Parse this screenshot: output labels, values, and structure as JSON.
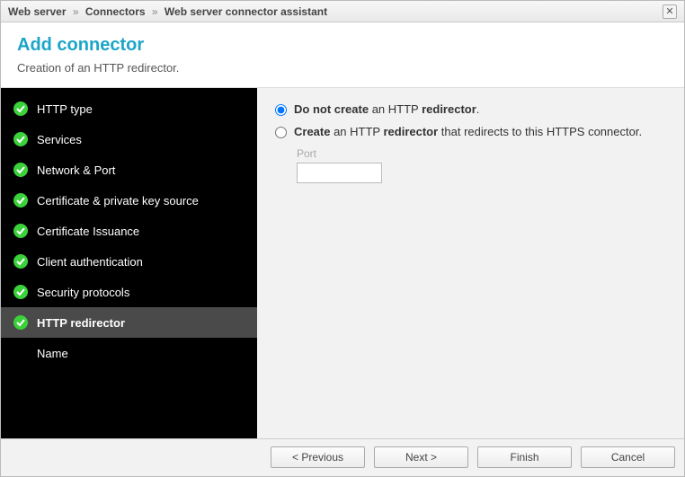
{
  "breadcrumb": {
    "p1": "Web server",
    "p2": "Connectors",
    "p3": "Web server connector assistant"
  },
  "header": {
    "title": "Add connector",
    "subtitle": "Creation of an HTTP redirector."
  },
  "sidebar": {
    "steps": [
      {
        "label": "HTTP type",
        "done": true
      },
      {
        "label": "Services",
        "done": true
      },
      {
        "label": "Network & Port",
        "done": true
      },
      {
        "label": "Certificate & private key source",
        "done": true
      },
      {
        "label": "Certificate Issuance",
        "done": true
      },
      {
        "label": "Client authentication",
        "done": true
      },
      {
        "label": "Security protocols",
        "done": true
      },
      {
        "label": "HTTP redirector",
        "done": true,
        "active": true
      },
      {
        "label": "Name",
        "done": false
      }
    ]
  },
  "options": {
    "opt1_b1": "Do not create",
    "opt1_plain": " an HTTP ",
    "opt1_b2": "redirector",
    "opt1_tail": ".",
    "opt2_b1": "Create",
    "opt2_plain1": " an HTTP ",
    "opt2_b2": "redirector",
    "opt2_plain2": " that redirects to this HTTPS connector.",
    "port_label": "Port",
    "port_value": "",
    "selected": "no_create"
  },
  "footer": {
    "previous": "< Previous",
    "next": "Next >",
    "finish": "Finish",
    "cancel": "Cancel"
  }
}
